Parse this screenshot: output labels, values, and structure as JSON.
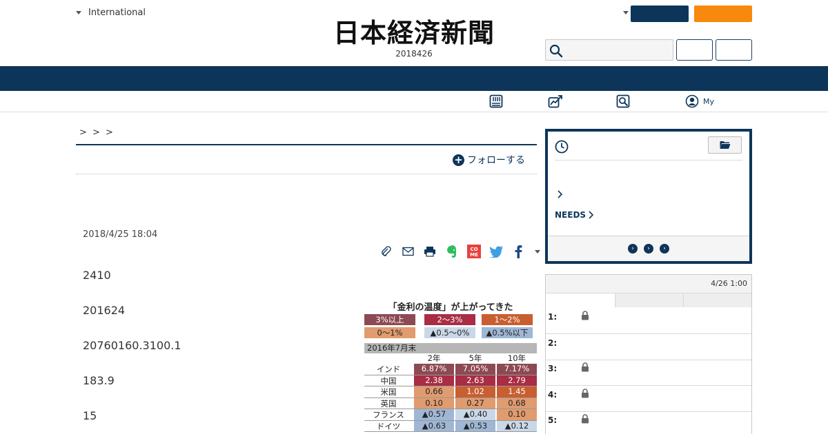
{
  "header": {
    "international_label": "International",
    "logo_text": "日本経済新聞",
    "edition_date": "2018426"
  },
  "subnav": {
    "items": [
      {
        "icon": "newspaper-icon",
        "label": ""
      },
      {
        "icon": "chart-icon",
        "label": ""
      },
      {
        "icon": "search-doc-icon",
        "label": ""
      },
      {
        "icon": "user-circle-icon",
        "label": "My"
      }
    ]
  },
  "article": {
    "breadcrumb": "> > >",
    "follow_label": "フォローする",
    "published": "2018/4/25 18:04",
    "paragraphs": [
      "2410",
      "201624",
      "20760160.3100.1",
      "183.9",
      "15"
    ]
  },
  "share_icons": [
    "clip-icon",
    "mail-icon",
    "print-icon",
    "evernote-icon",
    "come-icon",
    "twitter-icon",
    "facebook-icon",
    "more-caret-icon"
  ],
  "figure": {
    "title": "「金利の温度」が上がってきた",
    "legend": [
      {
        "label": "3%以上",
        "bg": "#8c4a52",
        "fg": "#ffffff"
      },
      {
        "label": "2～3%",
        "bg": "#a82d45",
        "fg": "#ffffff"
      },
      {
        "label": "1～2%",
        "bg": "#c95e30",
        "fg": "#ffffff"
      },
      {
        "label": "0～1%",
        "bg": "#e09b6e",
        "fg": "#222222"
      },
      {
        "label": "▲0.5～0%",
        "bg": "#c9d8e8",
        "fg": "#222222"
      },
      {
        "label": "▲0.5%以下",
        "bg": "#9fb7d5",
        "fg": "#222222"
      }
    ],
    "table_heading": "2016年7月末",
    "columns": [
      "2年",
      "5年",
      "10年"
    ],
    "rows": [
      {
        "country": "インド",
        "values": [
          "6.87%",
          "7.05%",
          "7.17%"
        ],
        "colors": [
          "#8c4a52",
          "#8c4a52",
          "#8c4a52"
        ]
      },
      {
        "country": "中国",
        "values": [
          "2.38",
          "2.63",
          "2.79"
        ],
        "colors": [
          "#a82d45",
          "#a82d45",
          "#a82d45"
        ]
      },
      {
        "country": "米国",
        "values": [
          "0.66",
          "1.02",
          "1.45"
        ],
        "colors": [
          "#e09b6e",
          "#c95e30",
          "#c95e30"
        ]
      },
      {
        "country": "英国",
        "values": [
          "0.10",
          "0.27",
          "0.68"
        ],
        "colors": [
          "#e09b6e",
          "#e09b6e",
          "#e09b6e"
        ]
      },
      {
        "country": "フランス",
        "values": [
          "▲0.57",
          "▲0.40",
          "0.10"
        ],
        "colors": [
          "#9fb7d5",
          "#c9d8e8",
          "#e09b6e"
        ]
      },
      {
        "country": "ドイツ",
        "values": [
          "▲0.63",
          "▲0.53",
          "▲0.12"
        ],
        "colors": [
          "#9fb7d5",
          "#9fb7d5",
          "#c9d8e8"
        ]
      }
    ]
  },
  "sidebar": {
    "needs_label": "NEEDS",
    "ranking_time": "4/26 1:00",
    "ranking": [
      {
        "rank": "1:",
        "locked": true
      },
      {
        "rank": "2:",
        "locked": false
      },
      {
        "rank": "3:",
        "locked": true
      },
      {
        "rank": "4:",
        "locked": true
      },
      {
        "rank": "5:",
        "locked": true
      }
    ]
  },
  "colors": {
    "navy": "#0d3559",
    "orange": "#f7890c"
  }
}
